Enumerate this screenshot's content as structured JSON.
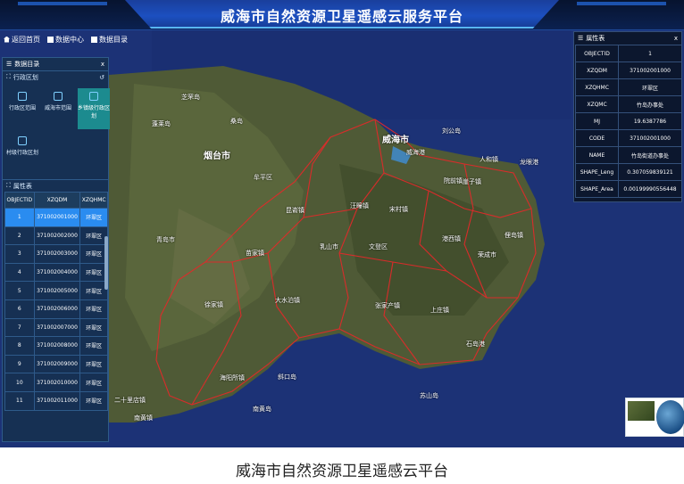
{
  "header": {
    "title": "威海市自然资源卫星遥感云服务平台"
  },
  "toolbar": {
    "items": [
      {
        "label": "返回首页",
        "icon": "home-icon"
      },
      {
        "label": "数据中心",
        "icon": "database-icon"
      },
      {
        "label": "数据目录",
        "icon": "catalog-icon"
      }
    ]
  },
  "left_panel": {
    "title": "数据目录",
    "close": "x",
    "region_section": "行政区划",
    "regions": [
      {
        "label": "行政区范围",
        "active": false
      },
      {
        "label": "威海市范围",
        "active": false
      },
      {
        "label": "乡镇级行政区划",
        "active": true
      },
      {
        "label": "村级行政区划",
        "active": false
      }
    ],
    "attr_section": "属性表",
    "attr_columns": [
      "OBJECTID",
      "XZQDM",
      "XZQHMC"
    ],
    "attr_rows": [
      [
        "1",
        "371002001000",
        "环翠区"
      ],
      [
        "2",
        "371002002000",
        "环翠区"
      ],
      [
        "3",
        "371002003000",
        "环翠区"
      ],
      [
        "4",
        "371002004000",
        "环翠区"
      ],
      [
        "5",
        "371002005000",
        "环翠区"
      ],
      [
        "6",
        "371002006000",
        "环翠区"
      ],
      [
        "7",
        "371002007000",
        "环翠区"
      ],
      [
        "8",
        "371002008000",
        "环翠区"
      ],
      [
        "9",
        "371002009000",
        "环翠区"
      ],
      [
        "10",
        "371002010000",
        "环翠区"
      ],
      [
        "11",
        "371002011000",
        "环翠区"
      ]
    ]
  },
  "right_panel": {
    "title": "属性表",
    "close": "x",
    "rows": [
      [
        "OBJECTID",
        "1"
      ],
      [
        "XZQDM",
        "371002001000"
      ],
      [
        "XZQHMC",
        "环翠区"
      ],
      [
        "XZQMC",
        "竹岛办事处"
      ],
      [
        "MJ",
        "19.6387786"
      ],
      [
        "CODE",
        "371002001000"
      ],
      [
        "NAME",
        "竹岛街道办事处"
      ],
      [
        "SHAPE_Leng",
        "0.307059839121"
      ],
      [
        "SHAPE_Area",
        "0.00199990556448"
      ]
    ]
  },
  "map": {
    "places": [
      "芝罘岛",
      "烟台市",
      "威海市",
      "威海港",
      "文登区",
      "乳山市",
      "石岛港",
      "龙眼港",
      "刘公岛",
      "蓬莱岛",
      "牟平区",
      "昆嵛镇",
      "汪疃镇",
      "苗家镇",
      "宋村镇",
      "张家产镇",
      "大水泊镇",
      "荣成市",
      "俚岛镇",
      "港西镇",
      "人和镇",
      "上庄镇",
      "崖子镇",
      "海阳所镇",
      "南黄镇",
      "二十里店镇",
      "徐家镇",
      "青岛市",
      "苏山岛",
      "南黄岛",
      "斜口岛",
      "桑岛",
      "院前镇"
    ]
  },
  "caption": "威海市自然资源卫星遥感云平台",
  "colors": {
    "header_bg": "#0b2150",
    "title_plate": "#1c4fc0",
    "selected_row": "#2a8cf0",
    "boundary": "#e02a2a",
    "active_region": "#1c8b8f"
  }
}
